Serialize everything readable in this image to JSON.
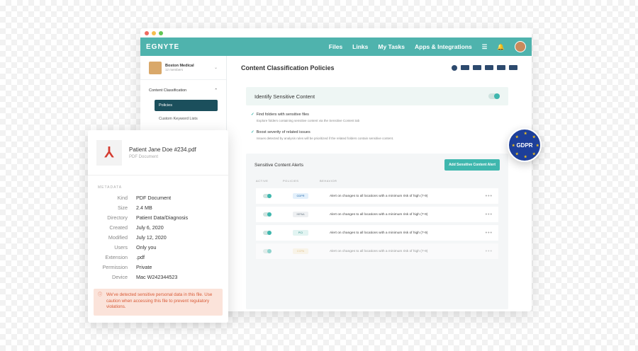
{
  "nav": {
    "logo": "EGNYTE",
    "files": "Files",
    "links": "Links",
    "tasks": "My Tasks",
    "apps": "Apps & Integrations"
  },
  "sidebar": {
    "org_name": "Boston Medical",
    "org_sub": "12 members",
    "section": "Content Classification",
    "policies": "Policies",
    "keywords": "Custom Keyword Lists"
  },
  "main": {
    "title": "Content Classification Policies",
    "identify": "Identify Sensitive Content",
    "find_title": "Find folders with sensitive files",
    "find_desc": "Explore folders containing sensitive content via the Sensitive Content tab",
    "boost_title": "Boost severity of related issues",
    "boost_desc": "Issues detected by analysis rules will be prioritized if the related folders contain sensitive content.",
    "alerts_title": "Sensitive Content Alerts",
    "add_btn": "Add Sensitive Content Alert",
    "cols": {
      "active": "ACTIVE",
      "policies": "POLICIES",
      "behavior": "BEHAVIOR"
    },
    "rows": [
      {
        "policy": "GDPR",
        "behavior": "Alert on changes to all locations with a minimum risk of high (7-9)",
        "bg": "#e3f0fb",
        "fg": "#2c6fb0"
      },
      {
        "policy": "HIPAA",
        "behavior": "Alert on changes to all locations with a minimum risk of high (7-9)",
        "bg": "#eef0f2",
        "fg": "#6c7a86"
      },
      {
        "policy": "PCI",
        "behavior": "Alert on changes to all locations with a minimum risk of high (7-9)",
        "bg": "#e2f4f2",
        "fg": "#2d8f87"
      },
      {
        "policy": "CCPA",
        "behavior": "Alert on changes to all locations with a minimum risk of high (7-9)",
        "bg": "#fdf1dd",
        "fg": "#d49b3a"
      }
    ]
  },
  "file": {
    "name": "Patient Jane Doe #234.pdf",
    "type": "PDF Document",
    "meta_label": "METADATA",
    "meta": [
      {
        "k": "Kind",
        "v": "PDF Document"
      },
      {
        "k": "Size",
        "v": "2.4 MB"
      },
      {
        "k": "Directory",
        "v": "Patient Data/Diagnosis"
      },
      {
        "k": "Created",
        "v": "July 6, 2020"
      },
      {
        "k": "Modified",
        "v": "July 12, 2020"
      },
      {
        "k": "Users",
        "v": "Only you"
      },
      {
        "k": "Extension",
        "v": ".pdf"
      },
      {
        "k": "Permission",
        "v": "Private"
      },
      {
        "k": "Device",
        "v": "Mac W242344523"
      }
    ],
    "warning": "We've detected sensitive personal data in this file. Use caution when accessing this file to prevent regulatory violations."
  },
  "gdpr": "GDPR"
}
